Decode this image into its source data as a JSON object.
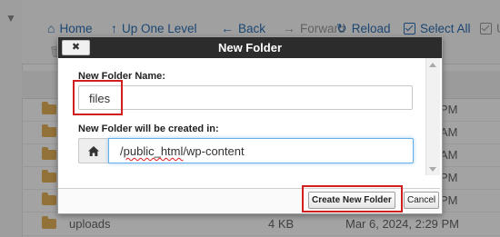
{
  "toolbar": {
    "home": "Home",
    "up_one_level": "Up One Level",
    "back": "Back",
    "forward": "Forward",
    "reload": "Reload",
    "select_all": "Select All",
    "unselect_fragment": "U"
  },
  "rows": [
    {
      "date_fragment": "PM"
    },
    {
      "date_fragment": "AM"
    },
    {
      "date_fragment": "AM"
    },
    {
      "date_fragment": "PM"
    },
    {
      "date_fragment": "PM"
    },
    {
      "name": "uploads",
      "size": "4 KB",
      "date": "Mar 6, 2024, 2:29 PM"
    }
  ],
  "dialog": {
    "title": "New Folder",
    "close_label": "✖",
    "name_label": "New Folder Name:",
    "name_value": "files",
    "location_label": "New Folder will be created in:",
    "path_prefix": "/",
    "path_misspelled": "public_html",
    "path_suffix": "/wp-content",
    "create_button": "Create New Folder",
    "cancel_button": "Cancel"
  },
  "colors": {
    "highlight": "#d11f1f",
    "link": "#2d6fb4",
    "folder": "#e6b35a"
  },
  "icons": [
    "home-icon",
    "up-arrow-icon",
    "back-arrow-icon",
    "forward-arrow-icon",
    "reload-icon",
    "checkbox-icon",
    "trash-icon",
    "folder-icon",
    "close-icon"
  ]
}
